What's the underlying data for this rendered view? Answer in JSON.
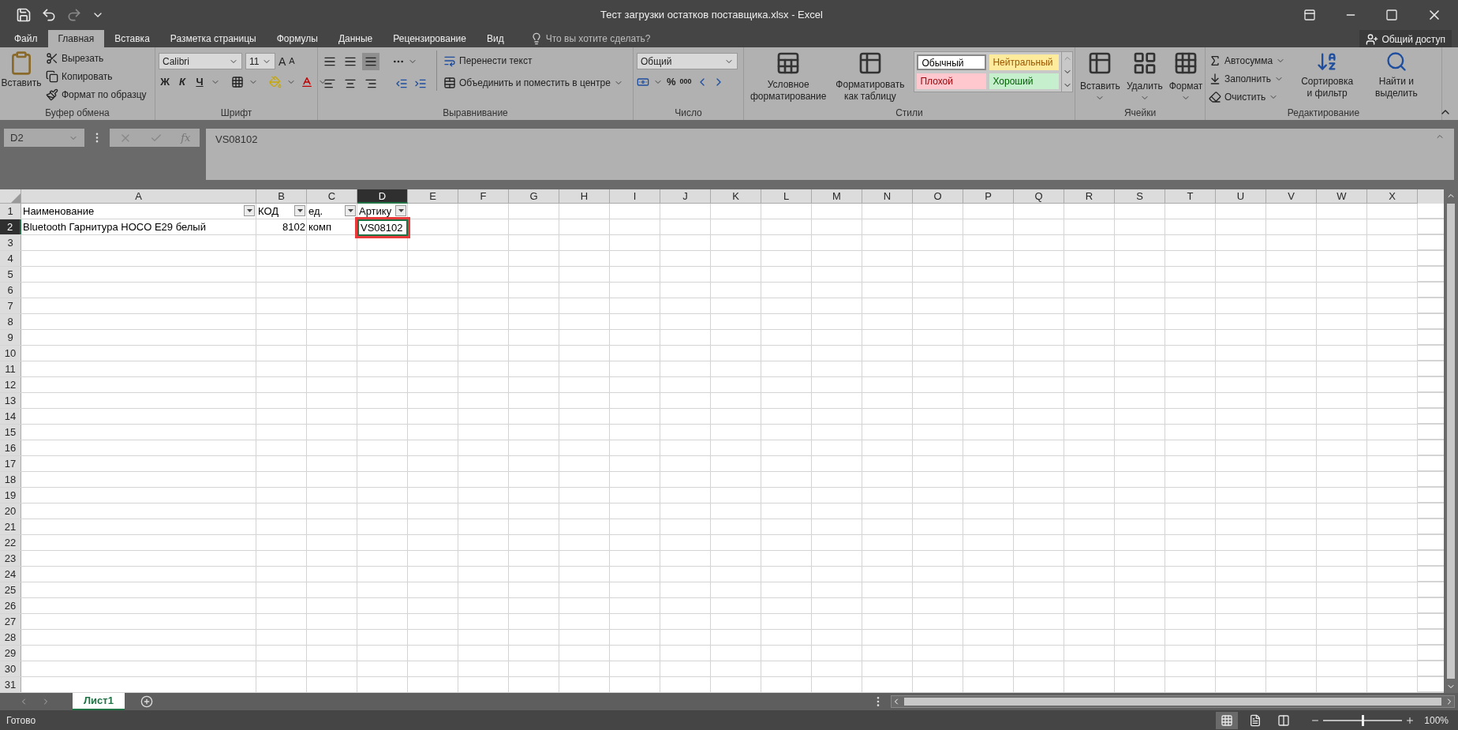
{
  "window": {
    "title": "Тест загрузки остатков поставщика.xlsx - Excel"
  },
  "menu_tabs": [
    {
      "label": "Файл",
      "selected": false
    },
    {
      "label": "Главная",
      "selected": true
    },
    {
      "label": "Вставка",
      "selected": false
    },
    {
      "label": "Разметка страницы",
      "selected": false
    },
    {
      "label": "Формулы",
      "selected": false
    },
    {
      "label": "Данные",
      "selected": false
    },
    {
      "label": "Рецензирование",
      "selected": false
    },
    {
      "label": "Вид",
      "selected": false
    }
  ],
  "tell_me": {
    "placeholder": "Что вы хотите сделать?"
  },
  "share": {
    "label": "Общий доступ"
  },
  "ribbon": {
    "clipboard": {
      "title": "Буфер обмена",
      "paste": "Вставить",
      "items": [
        {
          "kind": "cut",
          "label": "Вырезать"
        },
        {
          "kind": "copy",
          "label": "Копировать"
        },
        {
          "kind": "painter",
          "label": "Формат по образцу"
        }
      ]
    },
    "font": {
      "title": "Шрифт",
      "family": "Calibri",
      "size": "11",
      "grow": "A",
      "shrink": "A",
      "bold": "Ж",
      "italic": "К",
      "underline": "Ч"
    },
    "alignment": {
      "title": "Выравнивание",
      "wrap": "Перенести текст",
      "merge": "Объединить и поместить в центре",
      "vertical_align": [
        {
          "selected": false
        },
        {
          "selected": false
        },
        {
          "selected": true
        }
      ]
    },
    "number": {
      "title": "Число",
      "format": "Общий",
      "percent": "%",
      "thousands": "000"
    },
    "styles": {
      "title": "Стили",
      "buttons": [
        {
          "kind": "conditional",
          "lines": [
            "Условное",
            "форматирование"
          ]
        },
        {
          "kind": "table",
          "lines": [
            "Форматировать",
            "как таблицу"
          ]
        }
      ],
      "cell_styles": [
        {
          "label": "Обычный",
          "kind": "normal",
          "color": "#ffffff"
        },
        {
          "label": "Нейтральный",
          "kind": "neutral",
          "color": "#ffeb9c"
        },
        {
          "label": "Плохой",
          "kind": "bad",
          "color": "#ffc7ce"
        },
        {
          "label": "Хороший",
          "kind": "good",
          "color": "#c6efce"
        }
      ]
    },
    "cells": {
      "title": "Ячейки",
      "buttons": [
        {
          "kind": "insert",
          "label": "Вставить"
        },
        {
          "kind": "delete",
          "label": "Удалить"
        },
        {
          "kind": "format",
          "label": "Формат"
        }
      ]
    },
    "editing": {
      "title": "Редактирование",
      "items": [
        {
          "kind": "sum",
          "label": "Автосумма"
        },
        {
          "kind": "fill",
          "label": "Заполнить"
        },
        {
          "kind": "clear",
          "label": "Очистить"
        }
      ],
      "buttons": [
        {
          "kind": "sort",
          "lines": [
            "Сортировка",
            "и фильтр"
          ]
        },
        {
          "kind": "find",
          "lines": [
            "Найти и",
            "выделить"
          ]
        }
      ]
    }
  },
  "formula_bar": {
    "name_box": "D2",
    "fx": "fx",
    "value": "VS08102"
  },
  "sheet": {
    "columns": [
      {
        "label": "A",
        "selected": false
      },
      {
        "label": "B",
        "selected": false
      },
      {
        "label": "C",
        "selected": false
      },
      {
        "label": "D",
        "selected": true
      },
      {
        "label": "E",
        "selected": false
      },
      {
        "label": "F",
        "selected": false
      },
      {
        "label": "G",
        "selected": false
      },
      {
        "label": "H",
        "selected": false
      },
      {
        "label": "I",
        "selected": false
      },
      {
        "label": "J",
        "selected": false
      },
      {
        "label": "K",
        "selected": false
      },
      {
        "label": "L",
        "selected": false
      },
      {
        "label": "M",
        "selected": false
      },
      {
        "label": "N",
        "selected": false
      },
      {
        "label": "O",
        "selected": false
      },
      {
        "label": "P",
        "selected": false
      },
      {
        "label": "Q",
        "selected": false
      },
      {
        "label": "R",
        "selected": false
      },
      {
        "label": "S",
        "selected": false
      },
      {
        "label": "T",
        "selected": false
      },
      {
        "label": "U",
        "selected": false
      },
      {
        "label": "V",
        "selected": false
      },
      {
        "label": "W",
        "selected": false
      },
      {
        "label": "X",
        "selected": false
      }
    ],
    "rows": [
      {
        "label": "1",
        "selected": false
      },
      {
        "label": "2",
        "selected": true
      },
      {
        "label": "3",
        "selected": false
      },
      {
        "label": "4",
        "selected": false
      },
      {
        "label": "5",
        "selected": false
      },
      {
        "label": "6",
        "selected": false
      },
      {
        "label": "7",
        "selected": false
      },
      {
        "label": "8",
        "selected": false
      },
      {
        "label": "9",
        "selected": false
      },
      {
        "label": "10",
        "selected": false
      },
      {
        "label": "11",
        "selected": false
      },
      {
        "label": "12",
        "selected": false
      },
      {
        "label": "13",
        "selected": false
      },
      {
        "label": "14",
        "selected": false
      },
      {
        "label": "15",
        "selected": false
      },
      {
        "label": "16",
        "selected": false
      },
      {
        "label": "17",
        "selected": false
      },
      {
        "label": "18",
        "selected": false
      },
      {
        "label": "19",
        "selected": false
      },
      {
        "label": "20",
        "selected": false
      },
      {
        "label": "21",
        "selected": false
      },
      {
        "label": "22",
        "selected": false
      },
      {
        "label": "23",
        "selected": false
      },
      {
        "label": "24",
        "selected": false
      },
      {
        "label": "25",
        "selected": false
      },
      {
        "label": "26",
        "selected": false
      },
      {
        "label": "27",
        "selected": false
      },
      {
        "label": "28",
        "selected": false
      },
      {
        "label": "29",
        "selected": false
      },
      {
        "label": "30",
        "selected": false
      },
      {
        "label": "31",
        "selected": false
      }
    ],
    "cells": [
      [
        {
          "text": "Наименование",
          "kind": "text",
          "filter": true,
          "active": false,
          "outlined": false
        },
        {
          "text": "КОД",
          "kind": "text",
          "filter": true,
          "active": false,
          "outlined": false
        },
        {
          "text": "ед.",
          "kind": "text",
          "filter": true,
          "active": false,
          "outlined": false
        },
        {
          "text": "Артику",
          "kind": "text",
          "filter": true,
          "active": false,
          "outlined": false
        }
      ],
      [
        {
          "text": "Bluetooth Гарнитура HOCO E29 белый",
          "kind": "text",
          "filter": false,
          "active": false,
          "outlined": false
        },
        {
          "text": "8102",
          "kind": "number",
          "filter": false,
          "active": false,
          "outlined": false
        },
        {
          "text": "комп",
          "kind": "text",
          "filter": false,
          "active": false,
          "outlined": false
        },
        {
          "text": "VS08102",
          "kind": "text",
          "filter": false,
          "active": true,
          "outlined": true
        }
      ]
    ]
  },
  "sheet_tabs": [
    {
      "label": "Лист1",
      "selected": true
    }
  ],
  "status_bar": {
    "text": "Готово",
    "views": [
      {
        "kind": "normal",
        "selected": true
      },
      {
        "kind": "page_layout",
        "selected": false
      },
      {
        "kind": "page_break",
        "selected": false
      }
    ],
    "zoom": {
      "level": 0.5,
      "reading": "100%"
    }
  }
}
